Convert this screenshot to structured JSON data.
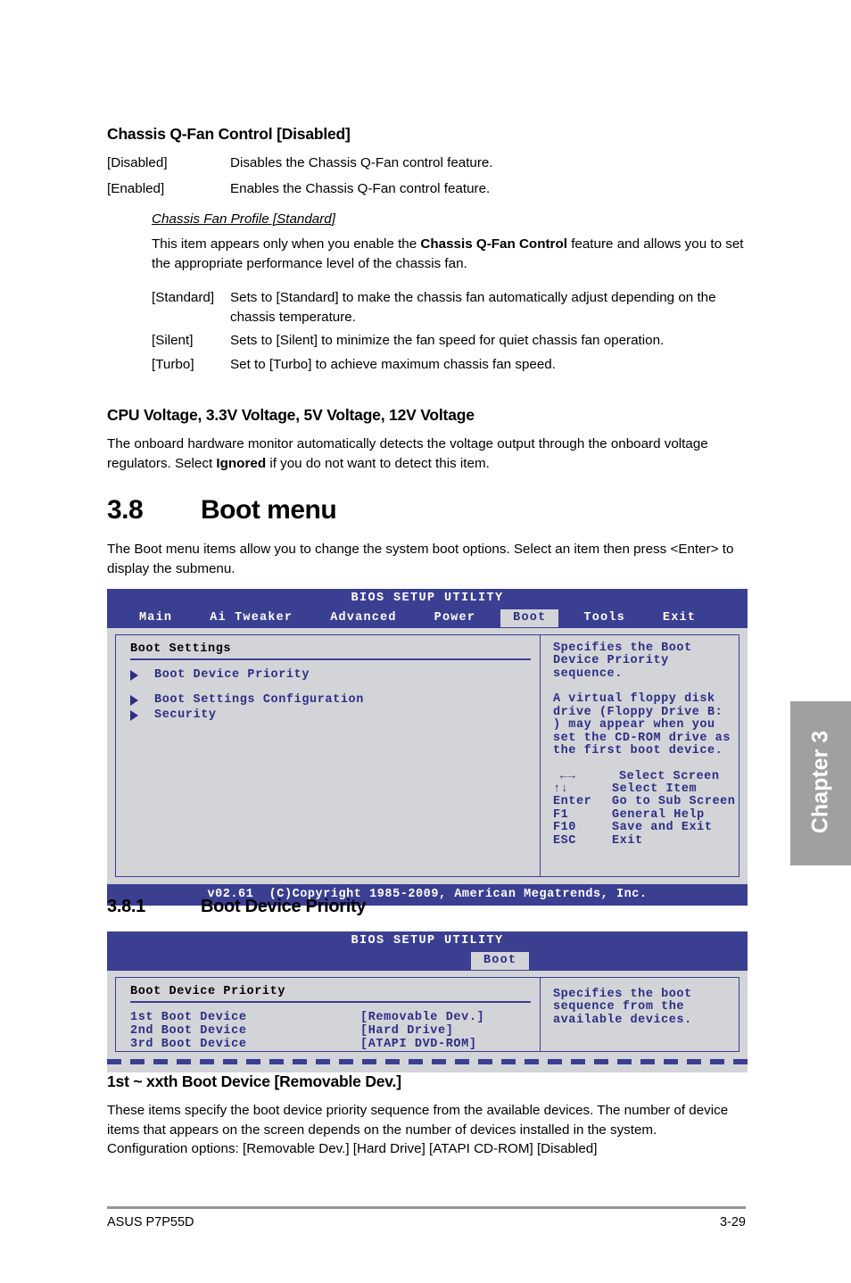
{
  "doc": {
    "footer_left": "ASUS P7P55D",
    "footer_right": "3-29",
    "chapter_tab": "Chapter 3"
  },
  "sections": {
    "qfan": {
      "heading": "Chassis Q-Fan Control [Disabled]",
      "options": [
        {
          "term": "[Disabled]",
          "desc": "Disables the Chassis Q-Fan control feature."
        },
        {
          "term": "[Enabled]",
          "desc": "Enables the Chassis Q-Fan control feature."
        }
      ],
      "sub": {
        "heading": "Chassis Fan Profile [Standard]",
        "para_pre": "This item appears only when you enable the ",
        "para_bold": "Chassis Q-Fan Control",
        "para_post": " feature and allows you to set the appropriate performance level of the chassis fan.",
        "options": [
          {
            "term": "[Standard]",
            "desc": "Sets to [Standard] to make the chassis fan automatically adjust depending on the chassis temperature."
          },
          {
            "term": "[Silent]",
            "desc": "Sets to [Silent] to minimize the fan speed for quiet chassis fan operation."
          },
          {
            "term": "[Turbo]",
            "desc": "Set to [Turbo] to achieve maximum chassis fan speed."
          }
        ]
      }
    },
    "voltage": {
      "heading": "CPU Voltage, 3.3V Voltage, 5V Voltage, 12V Voltage",
      "para_pre": "The onboard hardware monitor automatically detects the voltage output through the onboard voltage regulators. Select ",
      "para_bold": "Ignored",
      "para_post": " if you do not want to detect this item."
    },
    "boot_menu": {
      "number": "3.8",
      "title": "Boot menu",
      "para": "The Boot menu items allow you to change the system boot options. Select an item then press <Enter> to display the submenu."
    },
    "boot_device_priority": {
      "number": "3.8.1",
      "title": "Boot Device Priority"
    },
    "boot_device_item": {
      "heading": "1st ~ xxth Boot Device [Removable Dev.]",
      "para": "These items specify the boot device priority sequence from the available devices. The number of device items that appears on the screen depends on the number of devices installed in the system.",
      "config_options": "Configuration options: [Removable Dev.] [Hard Drive] [ATAPI CD-ROM] [Disabled]"
    }
  },
  "bios_screen_1": {
    "title": "BIOS SETUP UTILITY",
    "tabs": [
      {
        "label": "Main",
        "active": false
      },
      {
        "label": "Ai Tweaker",
        "active": false
      },
      {
        "label": "Advanced",
        "active": false
      },
      {
        "label": "Power",
        "active": false
      },
      {
        "label": "Boot",
        "active": true
      },
      {
        "label": "Tools",
        "active": false
      },
      {
        "label": "Exit",
        "active": false
      }
    ],
    "panel_title": "Boot Settings",
    "items": [
      "Boot Device Priority",
      "Boot Settings Configuration",
      "Security"
    ],
    "help_para_1": "Specifies the Boot Device Priority sequence.",
    "help_para_2": "A virtual floppy disk drive (Floppy Drive B:\n) may appear when you set the CD-ROM drive as the first boot device.",
    "keys": [
      {
        "key": "←→",
        "action": "Select Screen"
      },
      {
        "key": "↑↓",
        "action": "Select Item"
      },
      {
        "key": "Enter",
        "action": "Go to Sub Screen"
      },
      {
        "key": "F1",
        "action": "General Help"
      },
      {
        "key": "F10",
        "action": "Save and Exit"
      },
      {
        "key": "ESC",
        "action": "Exit"
      }
    ],
    "footer": "v02.61  (C)Copyright 1985-2009, American Megatrends, Inc."
  },
  "bios_screen_2": {
    "title": "BIOS SETUP UTILITY",
    "tabs": [
      {
        "label": "Boot",
        "active": true
      }
    ],
    "panel_title": "Boot Device Priority",
    "rows": [
      {
        "label": "1st Boot Device",
        "value": "[Removable Dev.]"
      },
      {
        "label": "2nd Boot Device",
        "value": "[Hard Drive]"
      },
      {
        "label": "3rd Boot Device",
        "value": "[ATAPI DVD-ROM]"
      }
    ],
    "help_para_1": "Specifies the boot sequence from the available devices."
  },
  "colors": {
    "bios_blue": "#3b3f92",
    "bios_text_blue": "#2b2f85",
    "bios_bg": "#d3d4d8",
    "chapter_tab_gray": "#a0a0a0"
  }
}
